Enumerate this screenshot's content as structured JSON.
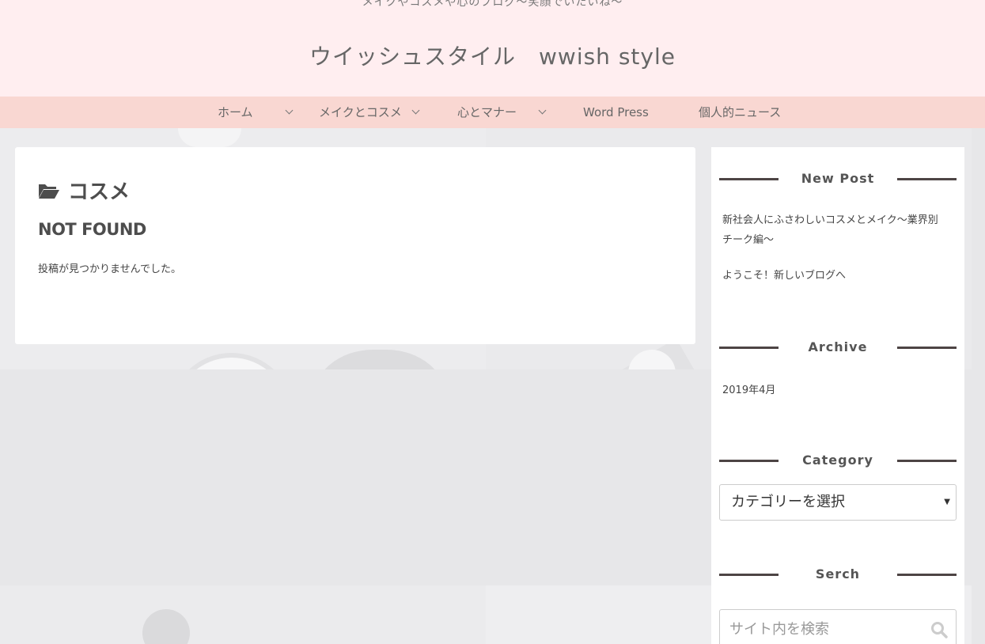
{
  "header": {
    "tagline": "メイクやコスメや心のブログ〜笑顔でいたいね〜",
    "site_title": "ウイッシュスタイル　wwish style"
  },
  "nav": {
    "items": [
      {
        "label": "ホーム",
        "has_dropdown": true
      },
      {
        "label": "メイクとコスメ",
        "has_dropdown": true
      },
      {
        "label": "心とマナー",
        "has_dropdown": true
      },
      {
        "label": "Word Press",
        "has_dropdown": false
      },
      {
        "label": "個人的ニュース",
        "has_dropdown": false
      }
    ]
  },
  "main": {
    "archive_title": "コスメ",
    "archive_icon": "folder-open-icon",
    "not_found": "NOT FOUND",
    "message": "投稿が見つかりませんでした。"
  },
  "sidebar": {
    "new_post_title": "New Post",
    "posts": [
      "新社会人にふさわしいコスメとメイク〜業界別　チーク編〜",
      "ようこそ！新しいブログへ"
    ],
    "archive_title": "Archive",
    "archives": [
      "2019年4月"
    ],
    "category_title": "Category",
    "category_select": "カテゴリーを選択",
    "search_title": "Serch",
    "search_placeholder": "サイト内を検索"
  },
  "colors": {
    "header_bg": "#ffeef0",
    "nav_bg": "#f9d7d2",
    "widget_line": "#4d4444"
  }
}
